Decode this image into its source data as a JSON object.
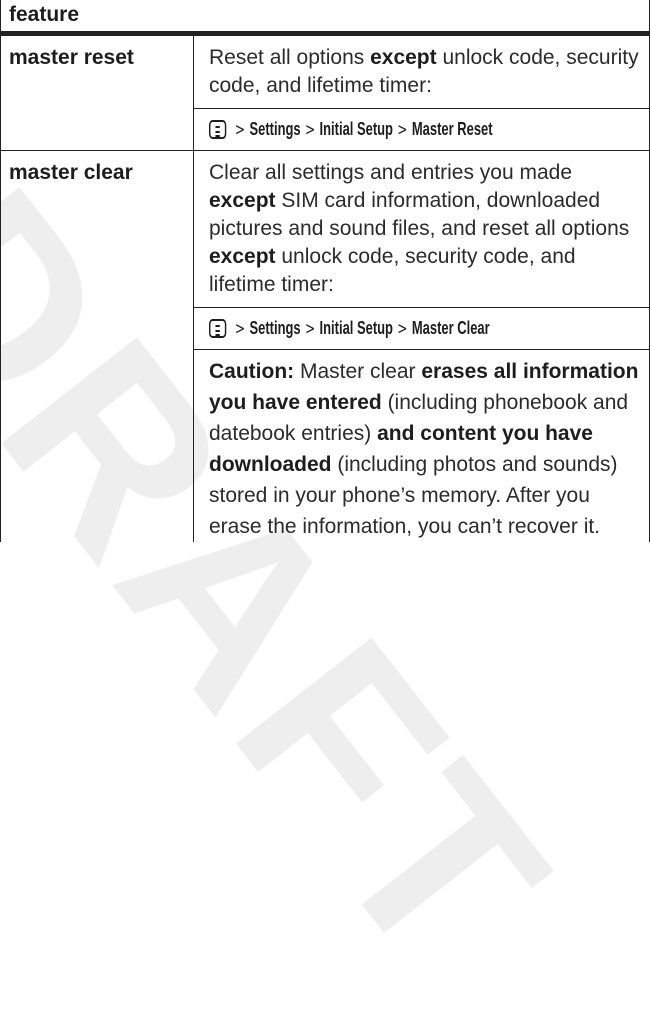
{
  "watermark": "DRAFT",
  "table": {
    "header": "feature",
    "rows": [
      {
        "feature": "master reset",
        "description": {
          "pre": "Reset all options ",
          "bold": "except",
          "post": " unlock code, security code, and lifetime timer:"
        },
        "path": [
          "Settings",
          "Initial Setup",
          "Master Reset"
        ]
      },
      {
        "feature": "master clear",
        "description": {
          "p1": "Clear all settings and entries you made ",
          "b1": "except",
          "p2": " SIM card information, downloaded pictures and sound files, and reset all options ",
          "b2": "except",
          "p3": " unlock code, security code, and lifetime timer:"
        },
        "path": [
          "Settings",
          "Initial Setup",
          "Master Clear"
        ],
        "caution": {
          "label": "Caution:",
          "t1": " Master clear ",
          "b1": "erases all information you have entered",
          "t2": " (including phonebook and datebook entries) ",
          "b2": "and content you have downloaded",
          "t3": " (including photos and sounds) stored in your phone’s memory. After you erase the information, you can’t recover it."
        }
      }
    ],
    "path_separator": ">",
    "menu_key_icon": "menu-key-icon"
  }
}
